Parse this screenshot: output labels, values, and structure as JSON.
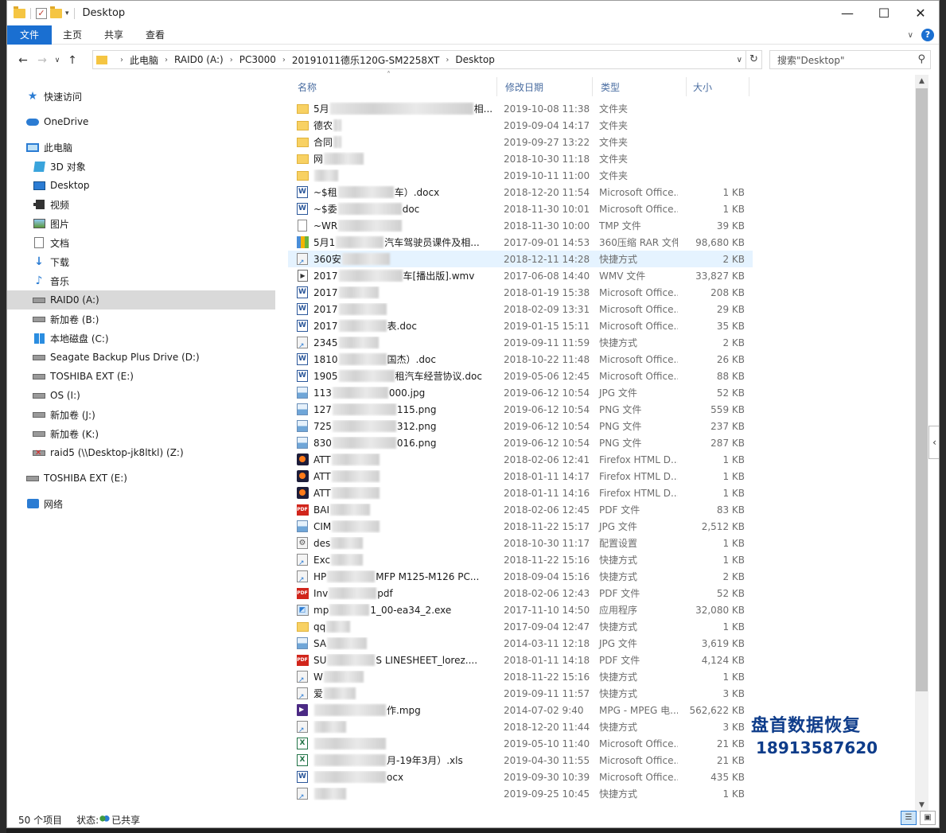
{
  "window": {
    "title": "Desktop"
  },
  "ribbon": {
    "tabs": [
      "文件",
      "主页",
      "共享",
      "查看"
    ]
  },
  "address": {
    "crumbs": [
      "此电脑",
      "RAID0 (A:)",
      "PC3000",
      "20191011德乐120G-SM2258XT",
      "Desktop"
    ]
  },
  "search": {
    "placeholder": "搜索\"Desktop\""
  },
  "sidebar": {
    "items": [
      {
        "label": "快速访问",
        "icon": "star-icon"
      },
      {
        "label": "OneDrive",
        "icon": "cloud-icon"
      },
      {
        "label": "此电脑",
        "icon": "computer-icon"
      },
      {
        "label": "3D 对象",
        "icon": "cube-icon"
      },
      {
        "label": "Desktop",
        "icon": "desktop-icon"
      },
      {
        "label": "视频",
        "icon": "video-icon"
      },
      {
        "label": "图片",
        "icon": "picture-icon"
      },
      {
        "label": "文档",
        "icon": "document-icon"
      },
      {
        "label": "下载",
        "icon": "download-icon"
      },
      {
        "label": "音乐",
        "icon": "music-icon"
      },
      {
        "label": "RAID0 (A:)",
        "icon": "drive-icon"
      },
      {
        "label": "新加卷 (B:)",
        "icon": "drive-icon"
      },
      {
        "label": "本地磁盘 (C:)",
        "icon": "windows-drive-icon"
      },
      {
        "label": "Seagate Backup Plus Drive (D:)",
        "icon": "drive-icon"
      },
      {
        "label": "TOSHIBA EXT (E:)",
        "icon": "drive-icon"
      },
      {
        "label": "OS (I:)",
        "icon": "drive-icon"
      },
      {
        "label": "新加卷 (J:)",
        "icon": "drive-icon"
      },
      {
        "label": "新加卷 (K:)",
        "icon": "drive-icon"
      },
      {
        "label": "raid5 (\\\\Desktop-jk8ltkl) (Z:)",
        "icon": "network-drive-icon"
      },
      {
        "label": "TOSHIBA EXT (E:)",
        "icon": "drive-icon"
      },
      {
        "label": "网络",
        "icon": "network-icon"
      }
    ]
  },
  "columns": {
    "name": "名称",
    "date": "修改日期",
    "type": "类型",
    "size": "大小"
  },
  "files": [
    {
      "icon": "folder",
      "pre": "5月",
      "post": "相...",
      "date": "2019-10-08 11:38",
      "type": "文件夹",
      "size": ""
    },
    {
      "icon": "folder",
      "pre": "德农",
      "post": "",
      "date": "2019-09-04 14:17",
      "type": "文件夹",
      "size": ""
    },
    {
      "icon": "folder",
      "pre": "合同",
      "post": "",
      "date": "2019-09-27 13:22",
      "type": "文件夹",
      "size": ""
    },
    {
      "icon": "folder",
      "pre": "网",
      "post": "",
      "date": "2018-10-30 11:18",
      "type": "文件夹",
      "size": ""
    },
    {
      "icon": "folder",
      "pre": "",
      "post": "",
      "date": "2019-10-11 11:00",
      "type": "文件夹",
      "size": ""
    },
    {
      "icon": "word",
      "pre": "~$租",
      "post": "车）.docx",
      "date": "2018-12-20 11:54",
      "type": "Microsoft Office...",
      "size": "1 KB"
    },
    {
      "icon": "word",
      "pre": "~$委",
      "post": "doc",
      "date": "2018-11-30 10:01",
      "type": "Microsoft Office...",
      "size": "1 KB"
    },
    {
      "icon": "file",
      "pre": "~WR",
      "post": "",
      "date": "2018-11-30 10:00",
      "type": "TMP 文件",
      "size": "39 KB"
    },
    {
      "icon": "rar",
      "pre": "5月1",
      "post": "汽车驾驶员课件及相...",
      "date": "2017-09-01 14:53",
      "type": "360压缩 RAR 文件",
      "size": "98,680 KB"
    },
    {
      "icon": "lnk",
      "pre": "360安",
      "post": "",
      "date": "2018-12-11 14:28",
      "type": "快捷方式",
      "size": "2 KB"
    },
    {
      "icon": "wmv",
      "pre": "2017",
      "post": "车[播出版].wmv",
      "date": "2017-06-08 14:40",
      "type": "WMV 文件",
      "size": "33,827 KB"
    },
    {
      "icon": "word",
      "pre": "2017",
      "post": "",
      "date": "2018-01-19 15:38",
      "type": "Microsoft Office...",
      "size": "208 KB"
    },
    {
      "icon": "word",
      "pre": "2017",
      "post": "",
      "date": "2018-02-09 13:31",
      "type": "Microsoft Office...",
      "size": "29 KB"
    },
    {
      "icon": "word",
      "pre": "2017",
      "post": "表.doc",
      "date": "2019-01-15 15:11",
      "type": "Microsoft Office...",
      "size": "35 KB"
    },
    {
      "icon": "lnk",
      "pre": "2345",
      "post": "",
      "date": "2019-09-11 11:59",
      "type": "快捷方式",
      "size": "2 KB"
    },
    {
      "icon": "word",
      "pre": "1810",
      "post": "国杰）.doc",
      "date": "2018-10-22 11:48",
      "type": "Microsoft Office...",
      "size": "26 KB"
    },
    {
      "icon": "word",
      "pre": "1905",
      "post": "租汽车经营协议.doc",
      "date": "2019-05-06 12:45",
      "type": "Microsoft Office...",
      "size": "88 KB"
    },
    {
      "icon": "img",
      "pre": "113",
      "post": "000.jpg",
      "date": "2019-06-12 10:54",
      "type": "JPG 文件",
      "size": "52 KB"
    },
    {
      "icon": "img",
      "pre": "127",
      "post": "115.png",
      "date": "2019-06-12 10:54",
      "type": "PNG 文件",
      "size": "559 KB"
    },
    {
      "icon": "img",
      "pre": "725",
      "post": "312.png",
      "date": "2019-06-12 10:54",
      "type": "PNG 文件",
      "size": "237 KB"
    },
    {
      "icon": "img",
      "pre": "830",
      "post": "016.png",
      "date": "2019-06-12 10:54",
      "type": "PNG 文件",
      "size": "287 KB"
    },
    {
      "icon": "ff",
      "pre": "ATT",
      "post": "",
      "date": "2018-02-06 12:41",
      "type": "Firefox HTML D...",
      "size": "1 KB"
    },
    {
      "icon": "ff",
      "pre": "ATT",
      "post": "",
      "date": "2018-01-11 14:17",
      "type": "Firefox HTML D...",
      "size": "1 KB"
    },
    {
      "icon": "ff",
      "pre": "ATT",
      "post": "",
      "date": "2018-01-11 14:16",
      "type": "Firefox HTML D...",
      "size": "1 KB"
    },
    {
      "icon": "pdf",
      "pre": "BAI",
      "post": "",
      "date": "2018-02-06 12:45",
      "type": "PDF 文件",
      "size": "83 KB"
    },
    {
      "icon": "img",
      "pre": "CIM",
      "post": "",
      "date": "2018-11-22 15:17",
      "type": "JPG 文件",
      "size": "2,512 KB"
    },
    {
      "icon": "cfg",
      "pre": "des",
      "post": "",
      "date": "2018-10-30 11:17",
      "type": "配置设置",
      "size": "1 KB"
    },
    {
      "icon": "lnk",
      "pre": "Exc",
      "post": "",
      "date": "2018-11-22 15:16",
      "type": "快捷方式",
      "size": "1 KB"
    },
    {
      "icon": "lnk",
      "pre": "HP",
      "post": "MFP M125-M126 PC...",
      "date": "2018-09-04 15:16",
      "type": "快捷方式",
      "size": "2 KB"
    },
    {
      "icon": "pdf",
      "pre": "Inv",
      "post": "pdf",
      "date": "2018-02-06 12:43",
      "type": "PDF 文件",
      "size": "52 KB"
    },
    {
      "icon": "exe",
      "pre": "mp",
      "post": "1_00-ea34_2.exe",
      "date": "2017-11-10 14:50",
      "type": "应用程序",
      "size": "32,080 KB"
    },
    {
      "icon": "folderlnk",
      "pre": "qq",
      "post": "",
      "date": "2017-09-04 12:47",
      "type": "快捷方式",
      "size": "1 KB"
    },
    {
      "icon": "img",
      "pre": "SA",
      "post": "",
      "date": "2014-03-11 12:18",
      "type": "JPG 文件",
      "size": "3,619 KB"
    },
    {
      "icon": "pdf",
      "pre": "SU",
      "post": "S LINESHEET_lorez....",
      "date": "2018-01-11 14:18",
      "type": "PDF 文件",
      "size": "4,124 KB"
    },
    {
      "icon": "lnk",
      "pre": "W",
      "post": "",
      "date": "2018-11-22 15:16",
      "type": "快捷方式",
      "size": "1 KB"
    },
    {
      "icon": "lnk",
      "pre": "爱",
      "post": "",
      "date": "2019-09-11 11:57",
      "type": "快捷方式",
      "size": "3 KB"
    },
    {
      "icon": "mpg",
      "pre": "",
      "post": "作.mpg",
      "date": "2014-07-02 9:40",
      "type": "MPG - MPEG 电...",
      "size": "562,622 KB"
    },
    {
      "icon": "lnk",
      "pre": "",
      "post": "",
      "date": "2018-12-20 11:44",
      "type": "快捷方式",
      "size": "3 KB"
    },
    {
      "icon": "excel",
      "pre": "",
      "post": "",
      "date": "2019-05-10 11:40",
      "type": "Microsoft Office...",
      "size": "21 KB"
    },
    {
      "icon": "excel",
      "pre": "",
      "post": "月-19年3月）.xls",
      "date": "2019-04-30 11:55",
      "type": "Microsoft Office...",
      "size": "21 KB"
    },
    {
      "icon": "word",
      "pre": "",
      "post": "ocx",
      "date": "2019-09-30 10:39",
      "type": "Microsoft Office...",
      "size": "435 KB"
    },
    {
      "icon": "lnk",
      "pre": "",
      "post": "",
      "date": "2019-09-25 10:45",
      "type": "快捷方式",
      "size": "1 KB"
    }
  ],
  "status": {
    "count": "50 个项目",
    "share_label": "状态:",
    "share_value": "已共享"
  },
  "watermark": {
    "title": "盘首数据恢复",
    "phone": "18913587620"
  }
}
